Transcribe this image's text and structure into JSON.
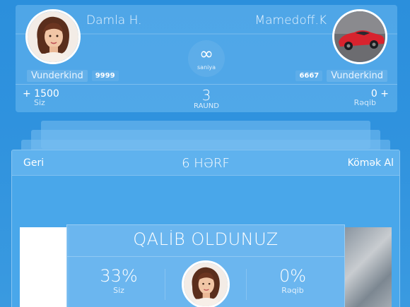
{
  "header": {
    "player_name": "Damla H.",
    "player_level": "Vunderkind",
    "player_points": "9999",
    "player_score": "+ 1500",
    "player_score_label": "Siz",
    "opponent_name": "Mamedoff.K",
    "opponent_level": "Vunderkind",
    "opponent_points": "6667",
    "opponent_score": "0 +",
    "opponent_score_label": "Rəqib",
    "timer_symbol": "∞",
    "timer_label": "saniya",
    "round_number": "3",
    "round_label": "RAUND"
  },
  "card": {
    "back_label": "Geri",
    "word_length": "6 HƏRF",
    "help_label": "Kömək Al"
  },
  "result": {
    "title": "QALİB OLDUNUZ",
    "player_percent": "33%",
    "player_label": "Siz",
    "opponent_percent": "0%",
    "opponent_label": "Rəqib"
  },
  "colors": {
    "background": "#2f92de",
    "panel": "#6eb9f0",
    "text": "#ffffff",
    "car": "#d8232e"
  },
  "icons": {
    "player_avatar": "woman-portrait-icon",
    "opponent_avatar": "red-car-icon",
    "timer": "infinity-icon"
  }
}
